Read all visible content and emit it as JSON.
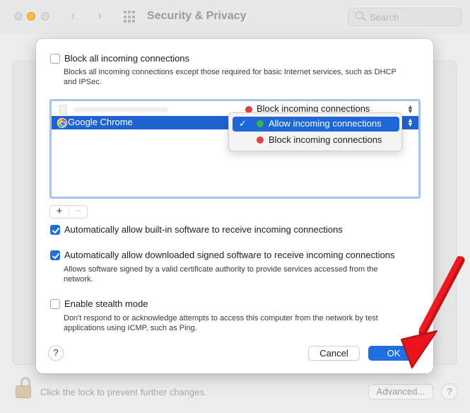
{
  "window": {
    "title": "Security & Privacy",
    "search_placeholder": "Search"
  },
  "nav": {
    "back_glyph": "‹",
    "forward_glyph": "›"
  },
  "sheet": {
    "block_all": {
      "label": "Block all incoming connections",
      "checked": false,
      "description": "Blocks all incoming connections except those required for basic Internet services, such as DHCP and IPSec."
    },
    "app_list": [
      {
        "name": "",
        "status": "Block incoming connections",
        "status_color": "#e0443e"
      },
      {
        "name": "Google Chrome",
        "status": "Allow incoming connections",
        "status_color": "#39b54a",
        "selected": true
      }
    ],
    "popup_menu": {
      "options": [
        {
          "label": "Allow incoming connections",
          "color": "#39b54a",
          "selected": true
        },
        {
          "label": "Block incoming connections",
          "color": "#e0443e",
          "selected": false
        }
      ]
    },
    "add_label": "+",
    "remove_label": "−",
    "auto_builtin": {
      "label": "Automatically allow built-in software to receive incoming connections",
      "checked": true
    },
    "auto_signed": {
      "label": "Automatically allow downloaded signed software to receive incoming connections",
      "checked": true,
      "description": "Allows software signed by a valid certificate authority to provide services accessed from the network."
    },
    "stealth": {
      "label": "Enable stealth mode",
      "checked": false,
      "description": "Don't respond to or acknowledge attempts to access this computer from the network by test applications using ICMP, such as Ping."
    },
    "help_label": "?",
    "cancel_label": "Cancel",
    "ok_label": "OK"
  },
  "footer": {
    "lock_text": "Click the lock to prevent further changes.",
    "advanced_label": "Advanced...",
    "help_label": "?"
  },
  "colors": {
    "accent": "#1f6fe0",
    "annotation_arrow": "#e8141c"
  }
}
